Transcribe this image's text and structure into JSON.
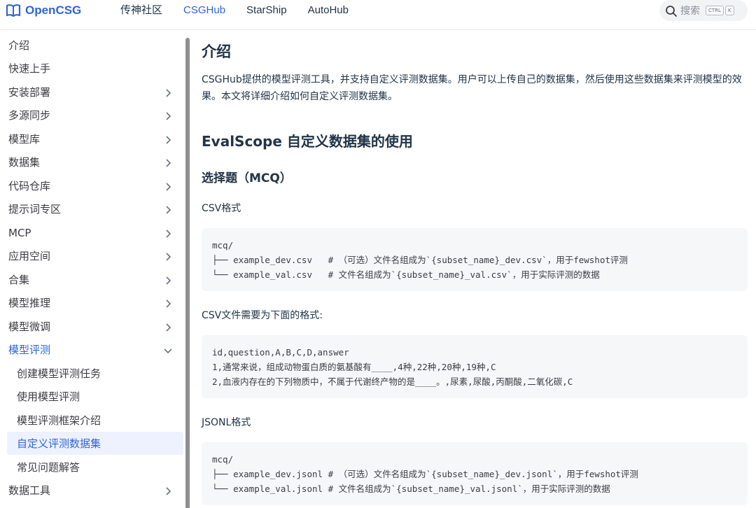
{
  "header": {
    "logo_text": "OpenCSG",
    "nav": [
      {
        "label": "传神社区",
        "active": false
      },
      {
        "label": "CSGHub",
        "active": true
      },
      {
        "label": "StarShip",
        "active": false
      },
      {
        "label": "AutoHub",
        "active": false
      }
    ],
    "search_label": "搜索",
    "shortcut_keys": [
      "CTRL",
      "K"
    ]
  },
  "sidebar": {
    "items": [
      {
        "label": "介绍",
        "has_children": false
      },
      {
        "label": "快速上手",
        "has_children": false
      },
      {
        "label": "安装部署",
        "has_children": true
      },
      {
        "label": "多源同步",
        "has_children": true
      },
      {
        "label": "模型库",
        "has_children": true
      },
      {
        "label": "数据集",
        "has_children": true
      },
      {
        "label": "代码仓库",
        "has_children": true
      },
      {
        "label": "提示词专区",
        "has_children": true
      },
      {
        "label": "MCP",
        "has_children": true
      },
      {
        "label": "应用空间",
        "has_children": true
      },
      {
        "label": "合集",
        "has_children": true
      },
      {
        "label": "模型推理",
        "has_children": true
      },
      {
        "label": "模型微调",
        "has_children": true
      },
      {
        "label": "模型评测",
        "has_children": true,
        "expanded": true,
        "active": true
      },
      {
        "label": "创建模型评测任务",
        "sub": true
      },
      {
        "label": "使用模型评测",
        "sub": true
      },
      {
        "label": "模型评测框架介绍",
        "sub": true
      },
      {
        "label": "自定义评测数据集",
        "sub": true,
        "selected": true
      },
      {
        "label": "常见问题解答",
        "sub": true
      },
      {
        "label": "数据工具",
        "has_children": true
      }
    ]
  },
  "content": {
    "title": "介绍",
    "intro": "CSGHub提供的模型评测工具，并支持自定义评测数据集。用户可以上传自己的数据集，然后使用这些数据集来评测模型的效果。本文将详细介绍如何自定义评测数据集。",
    "section_title": "EvalScope 自定义数据集的使用",
    "subsection_title": "选择题（MCQ）",
    "csv_heading": "CSV格式",
    "code1": "mcq/\n├── example_dev.csv   # （可选）文件名组成为`{subset_name}_dev.csv`，用于fewshot评测\n└── example_val.csv   # 文件名组成为`{subset_name}_val.csv`，用于实际评测的数据",
    "csv_format_note": "CSV文件需要为下面的格式:",
    "code2": "id,question,A,B,C,D,answer\n1,通常来说，组成动物蛋白质的氨基酸有____,4种,22种,20种,19种,C\n2,血液内存在的下列物质中，不属于代谢终产物的是____。,尿素,尿酸,丙酮酸,二氧化碳,C",
    "jsonl_heading": "JSONL格式",
    "code3": "mcq/\n├── example_dev.jsonl # （可选）文件名组成为`{subset_name}_dev.jsonl`，用于fewshot评测\n└── example_val.jsonl # 文件名组成为`{subset_name}_val.jsonl`，用于实际评测的数据"
  },
  "colors": {
    "accent": "#2f65d9",
    "text": "#213547",
    "code_bg": "#f6f7f9",
    "selected_bg": "#eef2ff"
  }
}
